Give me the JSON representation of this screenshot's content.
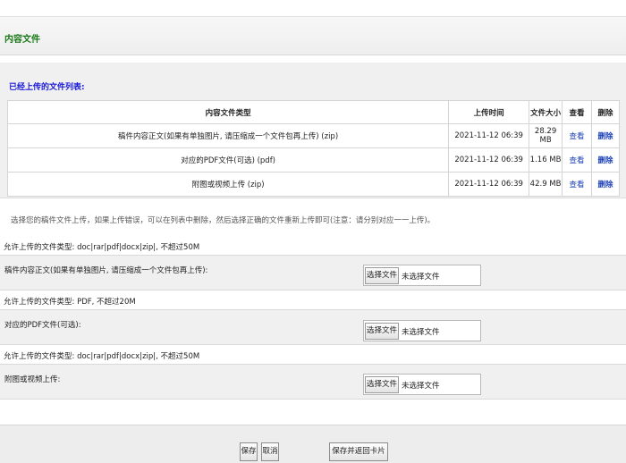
{
  "section": {
    "title": "内容文件"
  },
  "uploaded": {
    "title": "已经上传的文件列表:",
    "headers": [
      "内容文件类型",
      "上传时间",
      "文件大小",
      "查看",
      "删除"
    ],
    "rows": [
      {
        "type": "稿件内容正文(如果有单独图片, 请压缩成一个文件包再上传) (zip)",
        "time": "2021-11-12 06:39",
        "size": "28.29 MB",
        "view": "查看",
        "delete": "删除"
      },
      {
        "type": "对应的PDF文件(可选) (pdf)",
        "time": "2021-11-12 06:39",
        "size": "1.16 MB",
        "view": "查看",
        "delete": "删除"
      },
      {
        "type": "附图或视频上传 (zip)",
        "time": "2021-11-12 06:39",
        "size": "42.9 MB",
        "view": "查看",
        "delete": "删除"
      }
    ]
  },
  "note": "选择您的稿件文件上传，如果上传错误，可以在列表中删除，然后选择正确的文件重新上传即可(注意：请分别对应一一上传)。",
  "uploads": [
    {
      "allowed": "允许上传的文件类型: doc|rar|pdf|docx|zip|, 不超过50M",
      "label": "稿件内容正文(如果有单独图片, 请压缩成一个文件包再上传):",
      "button": "选择文件",
      "status": "未选择文件"
    },
    {
      "allowed": "允许上传的文件类型: PDF, 不超过20M",
      "label": "对应的PDF文件(可选):",
      "button": "选择文件",
      "status": "未选择文件"
    },
    {
      "allowed": "允许上传的文件类型: doc|rar|pdf|docx|zip|, 不超过50M",
      "label": "附图或视频上传:",
      "button": "选择文件",
      "status": "未选择文件"
    }
  ],
  "footer": {
    "save": "保存",
    "cancel": "取消",
    "save_return": "保存并返回卡片列表"
  },
  "colors": {
    "section_title": "#1c7a1c",
    "panel_title": "#1a1ad6",
    "link": "#1a3fb5"
  }
}
